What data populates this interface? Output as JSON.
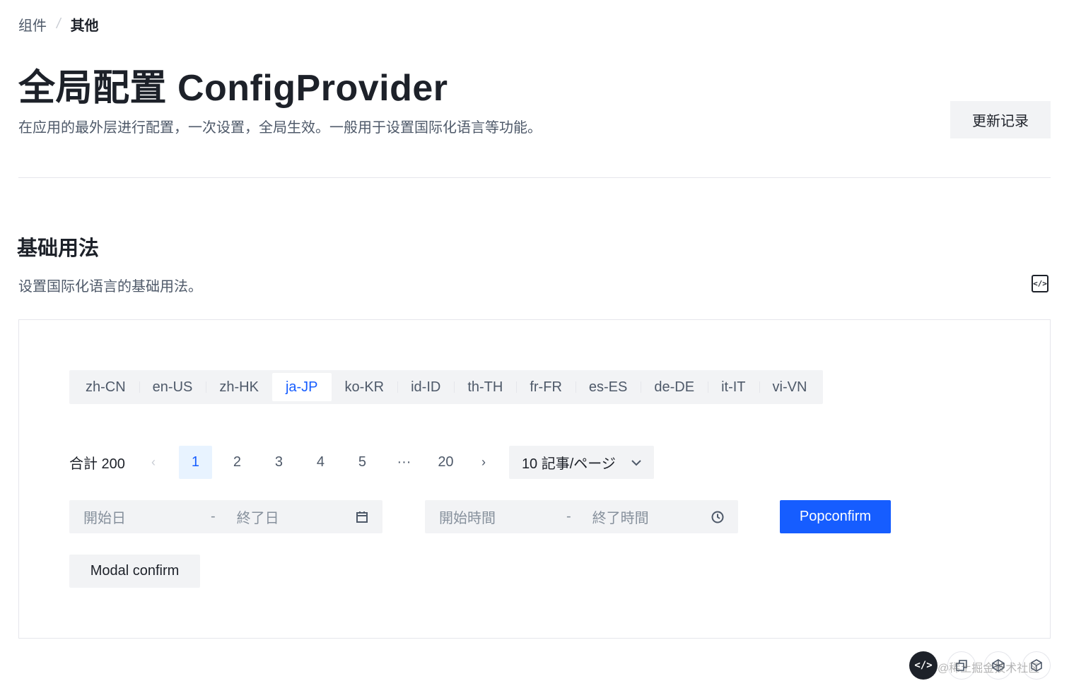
{
  "breadcrumb": {
    "parent": "组件",
    "separator": "/",
    "current": "其他"
  },
  "header": {
    "title": "全局配置 ConfigProvider",
    "description": "在应用的最外层进行配置，一次设置，全局生效。一般用于设置国际化语言等功能。",
    "changelog_label": "更新记录"
  },
  "section": {
    "title": "基础用法",
    "description": "设置国际化语言的基础用法。",
    "code_toggle_glyph": "</>"
  },
  "locales": {
    "items": [
      "zh-CN",
      "en-US",
      "zh-HK",
      "ja-JP",
      "ko-KR",
      "id-ID",
      "th-TH",
      "fr-FR",
      "es-ES",
      "de-DE",
      "it-IT",
      "vi-VN"
    ],
    "selected": "ja-JP"
  },
  "pagination": {
    "total": "合計 200",
    "prev": "‹",
    "next": "›",
    "pages": [
      "1",
      "2",
      "3",
      "4",
      "5",
      "···",
      "20"
    ],
    "current": "1",
    "page_size": "10 記事/ページ",
    "page_size_chevron": "⌄"
  },
  "date_range": {
    "start_placeholder": "開始日",
    "separator": "-",
    "end_placeholder": "終了日",
    "icon": "calendar-icon"
  },
  "time_range": {
    "start_placeholder": "開始時間",
    "separator": "-",
    "end_placeholder": "終了時間",
    "icon": "clock-icon"
  },
  "buttons": {
    "popconfirm": "Popconfirm",
    "modal_confirm": "Modal confirm"
  },
  "colors": {
    "primary": "#165dff",
    "primary_light": "#e8f3ff",
    "fill": "#f2f3f5",
    "text": "#1d2129",
    "text_secondary": "#4e5969",
    "placeholder": "#86909c",
    "border": "#e5e6eb"
  },
  "footer": {
    "watermark": "@稀土掘金技术社区",
    "fab_code": "</>",
    "fab_icons": [
      "copy-icon",
      "codepen-icon",
      "codesandbox-icon"
    ]
  }
}
